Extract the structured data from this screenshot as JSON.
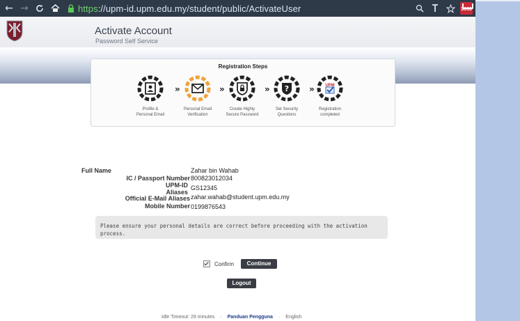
{
  "browser": {
    "back_icon": "←",
    "forward_icon": "→",
    "reload_icon": "C",
    "home_icon": "home",
    "url_scheme": "https",
    "url_rest": "://upm-id.upm.edu.my/student/public/ActivateUser"
  },
  "header": {
    "title": "Activate Account",
    "subtitle": "Password Self Service"
  },
  "steps": {
    "title": "Registration Steps",
    "items": [
      {
        "label": "Profile &\nPersonal Email",
        "icon": "profile-card-icon",
        "active": false
      },
      {
        "label": "Personal Email\nVerification",
        "icon": "envelope-icon",
        "active": true
      },
      {
        "label": "Create Highly\nSecure Password",
        "icon": "lock-shield-icon",
        "active": false
      },
      {
        "label": "Set Security\nQuestions",
        "icon": "question-shield-icon",
        "active": false
      },
      {
        "label": "Registration\ncompleted",
        "icon": "upm-check-icon",
        "active": false
      }
    ],
    "upm_badge": "UPM"
  },
  "details": {
    "full_name_label": "Full Name",
    "full_name": "Zahar bin Wahab",
    "ic_label": "IC / Passport Number",
    "ic": "800823012034",
    "upmid_label": "UPM-ID",
    "upmid": "GS12345",
    "aliases_label": "Aliases",
    "email_label": "Official E-Mail Aliases",
    "email": "zahar.wahab@student.upm.edu.my",
    "mobile_label": "Mobile Number",
    "mobile": "0199876543"
  },
  "notice": "Please ensure your personal details are correct before proceeding with the activation process.",
  "confirm_label": "Confirm",
  "continue_label": "Continue",
  "logout_label": "Logout",
  "footer": {
    "idle": "Idle Timeout: 29 minutes",
    "sep": "·",
    "guide": "Panduan Pengguna",
    "lang": "English"
  },
  "colors": {
    "active_step": "#f0a23a",
    "chrome_bg": "#2f3a49",
    "side_panel": "#b4c6e6"
  }
}
